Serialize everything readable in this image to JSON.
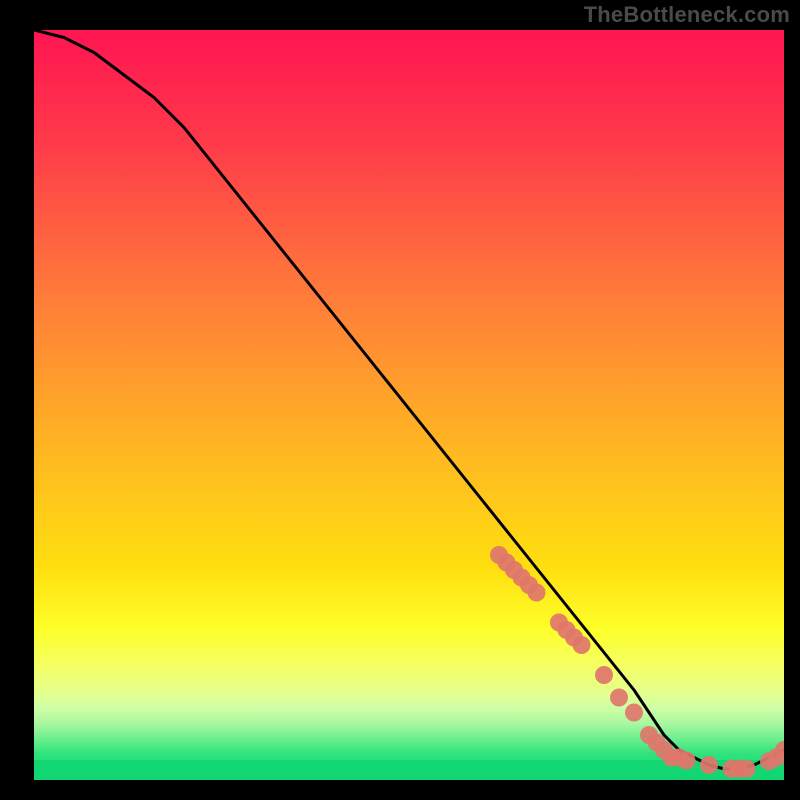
{
  "watermark": "TheBottleneck.com",
  "chart_data": {
    "type": "line",
    "title": "",
    "xlabel": "",
    "ylabel": "",
    "xlim": [
      0,
      100
    ],
    "ylim": [
      0,
      100
    ],
    "grid": false,
    "legend": false,
    "background_gradient": {
      "top": "#ff1a4b",
      "mid_upper": "#ff7a3a",
      "mid": "#ffd400",
      "mid_lower": "#f7ff55",
      "band": "#d8ff9a",
      "bottom": "#1de27a"
    },
    "curve": {
      "x": [
        0,
        4,
        8,
        12,
        16,
        20,
        24,
        28,
        32,
        36,
        40,
        44,
        48,
        52,
        56,
        60,
        64,
        68,
        72,
        76,
        80,
        82,
        84,
        86,
        88,
        90,
        92,
        94,
        96,
        98,
        100
      ],
      "y": [
        100,
        99,
        97,
        94,
        91,
        87,
        82,
        77,
        72,
        67,
        62,
        57,
        52,
        47,
        42,
        37,
        32,
        27,
        22,
        17,
        12,
        9,
        6,
        4,
        3,
        2,
        1.5,
        1.5,
        2,
        3,
        4
      ]
    },
    "markers": {
      "x": [
        62,
        63,
        64,
        65,
        66,
        67,
        70,
        71,
        72,
        73,
        76,
        78,
        80,
        82,
        83,
        84,
        85,
        86,
        87,
        90,
        93,
        94,
        95,
        98,
        99,
        100
      ],
      "y": [
        30,
        29,
        28,
        27,
        26,
        25,
        21,
        20,
        19,
        18,
        14,
        11,
        9,
        6,
        5,
        4,
        3,
        3,
        2.6,
        2,
        1.5,
        1.5,
        1.5,
        2.5,
        3,
        4
      ]
    }
  }
}
